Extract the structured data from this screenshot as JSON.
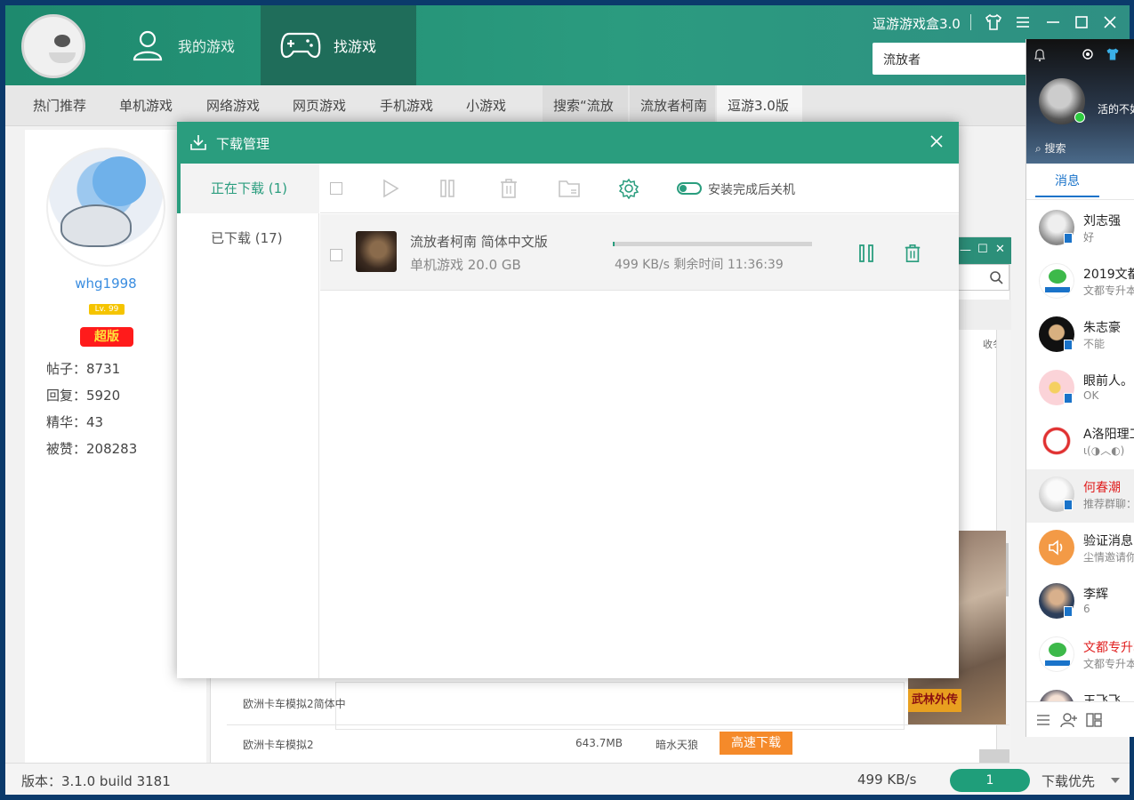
{
  "app": {
    "brand": "逗游游戏盒3.0",
    "nav": {
      "my_games": "我的游戏",
      "find_games": "找游戏"
    },
    "search": {
      "value": "流放者"
    },
    "subnav": {
      "items": [
        "热门推荐",
        "单机游戏",
        "网络游戏",
        "网页游戏",
        "手机游戏",
        "小游戏"
      ],
      "tabs": [
        "搜索“流放",
        "流放者柯南",
        "逗游3.0版"
      ]
    }
  },
  "profile": {
    "username": "whg1998",
    "level": "Lv. 99",
    "vip": "超版",
    "stats": [
      "帖子：8731",
      "回复：5920",
      "精华：43",
      "被赞：208283"
    ]
  },
  "background": {
    "rows": [
      {
        "name": "欧洲卡车模拟2简体中",
        "size": "",
        "publisher": ""
      },
      {
        "name": "欧洲卡车模拟2",
        "size": "643.7MB",
        "publisher": "暗水天狼"
      }
    ],
    "download_button": "高速下载",
    "image_label": "武林外传",
    "side_text": "收冬"
  },
  "dialog": {
    "title": "下载管理",
    "tabs": {
      "downloading": "正在下载 (1)",
      "downloaded": "已下载 (17)"
    },
    "toolbar": {
      "shutdown_toggle_label": "安装完成后关机"
    },
    "items": [
      {
        "title": "流放者柯南 简体中文版",
        "category": "单机游戏",
        "size": "20.0 GB",
        "meta": "单机游戏  20.0 GB",
        "speed": "499 KB/s  剩余时间 11:36:39",
        "progress": 0.01
      }
    ]
  },
  "statusbar": {
    "version": "版本：3.1.0 build 3181",
    "speed": "499 KB/s",
    "queue": "1",
    "priority": "下载优先"
  },
  "qq": {
    "signature": "活的不如",
    "search": "搜索",
    "tab": "消息",
    "contacts": [
      {
        "name": "刘志强",
        "msg": "好",
        "red": false
      },
      {
        "name": "2019文都",
        "msg": "文都专升本",
        "red": false
      },
      {
        "name": "朱志豪",
        "msg": "不能",
        "red": false
      },
      {
        "name": "眼前人。",
        "msg": " OK",
        "red": false
      },
      {
        "name": "A洛阳理工",
        "msg": "ι(◑︿◐)",
        "red": false
      },
      {
        "name": "何春潮",
        "msg": "推荐群聊：",
        "red": true
      },
      {
        "name": "验证消息",
        "msg": "尘情邀请你",
        "red": false
      },
      {
        "name": "李辉",
        "msg": "6",
        "red": false
      },
      {
        "name": "文都专升本",
        "msg": "文都专升本",
        "red": true
      },
      {
        "name": "王飞飞",
        "msg": "",
        "red": false
      }
    ]
  },
  "colors": {
    "accent": "#2a9d7e",
    "header": "#2b9b7f",
    "vip": "#ff1b1b",
    "download": "#f58a2a"
  }
}
